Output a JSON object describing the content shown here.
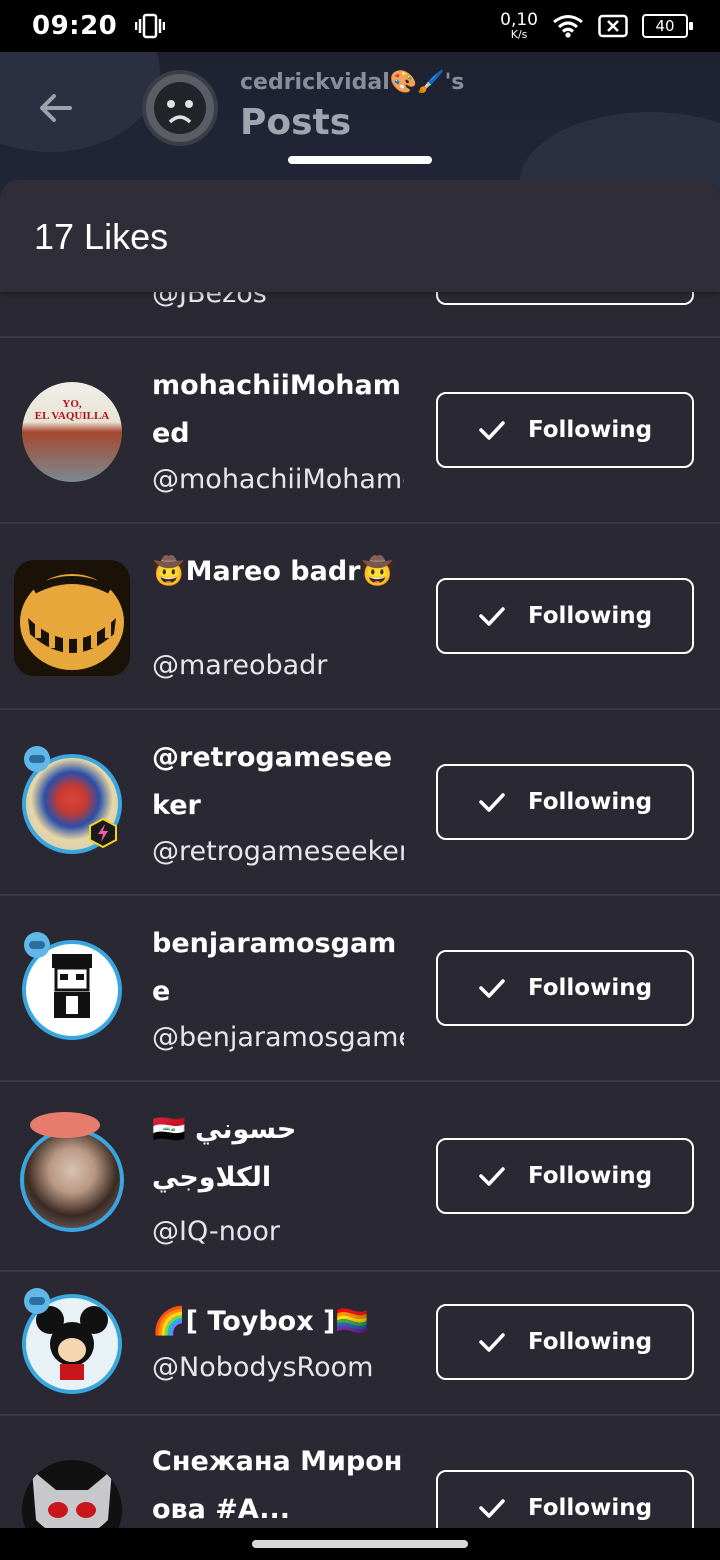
{
  "status_bar": {
    "time": "09:20",
    "net_speed_value": "0,10",
    "net_speed_unit": "K/s",
    "battery": "40"
  },
  "background": {
    "username": "cedrickvidal🎨🖌️'s",
    "title": "Posts"
  },
  "sheet": {
    "title": "17 Likes"
  },
  "users": [
    {
      "name": "",
      "handle": "@JBezos",
      "button": ""
    },
    {
      "name": "mohachiiMohamed",
      "handle": "@mohachiiMohamed",
      "button": "Following"
    },
    {
      "name": "🤠Mareo badr🤠",
      "handle": "@mareobadr",
      "button": "Following"
    },
    {
      "name": "@retrogameseeker",
      "handle": "@retrogameseeker",
      "button": "Following"
    },
    {
      "name": "benjaramosgame",
      "handle": "@benjaramosgame",
      "button": "Following"
    },
    {
      "name": "حسوني 🇮🇶 الكلاوجي",
      "handle": "@IQ-noor",
      "button": "Following"
    },
    {
      "name": "🌈[ Toybox ]🏳️‍🌈",
      "handle": "@NobodysRoom",
      "button": "Following"
    },
    {
      "name": "Снежана Миронова #A...",
      "handle": "",
      "button": "Following"
    }
  ]
}
